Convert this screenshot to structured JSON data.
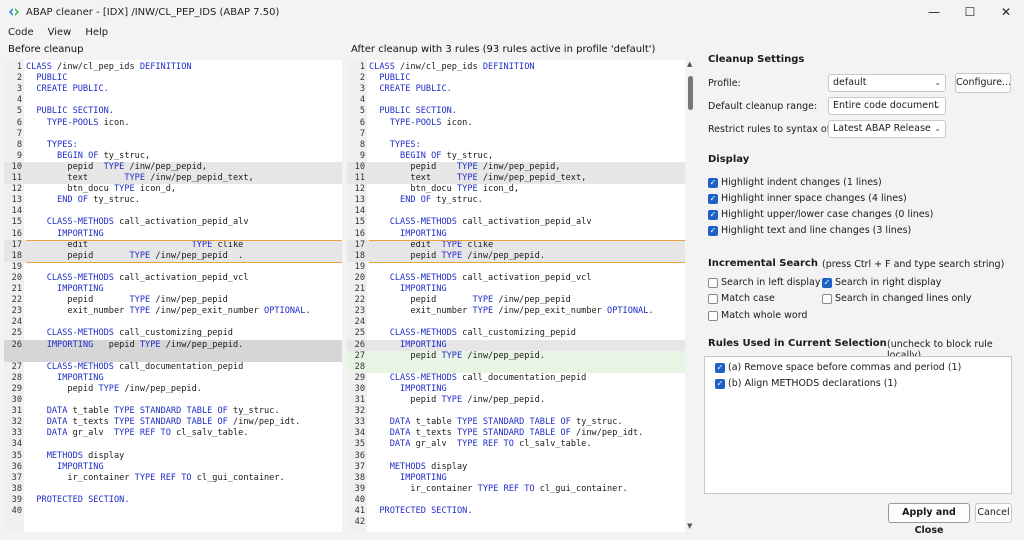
{
  "window": {
    "title": "ABAP cleaner - [IDX] /INW/CL_PEP_IDS (ABAP 7.50)",
    "minimize": "—",
    "maximize": "☐",
    "close": "✕"
  },
  "menu": [
    "Code",
    "View",
    "Help"
  ],
  "left_label": "Before cleanup",
  "right_label": "After cleanup with 3 rules (93 rules active in profile 'default')",
  "settings": {
    "title": "Cleanup Settings",
    "profile_label": "Profile:",
    "profile_value": "default",
    "configure": "Configure...",
    "range_label": "Default cleanup range:",
    "range_value": "Entire code document",
    "restrict_label": "Restrict rules to syntax of:",
    "restrict_value": "Latest ABAP Release",
    "display_title": "Display",
    "display_options": [
      "Highlight indent changes (1 lines)",
      "Highlight inner space changes (4 lines)",
      "Highlight upper/lower case changes (0 lines)",
      "Highlight text and line changes (3 lines)"
    ],
    "search_title": "Incremental Search",
    "search_hint": "(press Ctrl + F and type search string)",
    "search_left": "Search in left display",
    "search_right": "Search in right display",
    "match_case": "Match case",
    "search_changed": "Search in changed lines only",
    "match_whole": "Match whole word",
    "rules_title": "Rules Used in Current Selection",
    "rules_hint": "(uncheck to block rule locally)",
    "rules": [
      "(a) Remove space before commas and period (1)",
      "(b) Align METHODS declarations (1)"
    ],
    "apply": "Apply and Close",
    "cancel": "Cancel"
  },
  "left_lines": [
    {
      "n": "1",
      "t": "CLASS /inw/cl_pep_ids DEFINITION"
    },
    {
      "n": "2",
      "t": "  PUBLIC"
    },
    {
      "n": "3",
      "t": "  CREATE PUBLIC."
    },
    {
      "n": "4",
      "t": ""
    },
    {
      "n": "5",
      "t": "  PUBLIC SECTION."
    },
    {
      "n": "6",
      "t": "    TYPE-POOLS icon."
    },
    {
      "n": "7",
      "t": ""
    },
    {
      "n": "8",
      "t": "    TYPES:"
    },
    {
      "n": "9",
      "t": "      BEGIN OF ty_struc,"
    },
    {
      "n": "10",
      "t": "        pepid  TYPE /inw/pep_pepid,"
    },
    {
      "n": "11",
      "t": "        text       TYPE /inw/pep_pepid_text,"
    },
    {
      "n": "12",
      "t": "        btn_docu TYPE icon_d,"
    },
    {
      "n": "13",
      "t": "      END OF ty_struc."
    },
    {
      "n": "14",
      "t": ""
    },
    {
      "n": "15",
      "t": "    CLASS-METHODS call_activation_pepid_alv"
    },
    {
      "n": "16",
      "t": "      IMPORTING"
    },
    {
      "n": "17",
      "t": "        edit                    TYPE clike"
    },
    {
      "n": "18",
      "t": "        pepid       TYPE /inw/pep_pepid  ."
    },
    {
      "n": "19",
      "t": ""
    },
    {
      "n": "20",
      "t": "    CLASS-METHODS call_activation_pepid_vcl"
    },
    {
      "n": "21",
      "t": "      IMPORTING"
    },
    {
      "n": "22",
      "t": "        pepid       TYPE /inw/pep_pepid"
    },
    {
      "n": "23",
      "t": "        exit_number TYPE /inw/pep_exit_number OPTIONAL."
    },
    {
      "n": "24",
      "t": ""
    },
    {
      "n": "25",
      "t": "    CLASS-METHODS call_customizing_pepid"
    },
    {
      "n": "26",
      "t": "    IMPORTING   pepid TYPE /inw/pep_pepid."
    },
    {
      "n": "",
      "t": ""
    },
    {
      "n": "27",
      "t": "    CLASS-METHODS call_documentation_pepid"
    },
    {
      "n": "28",
      "t": "      IMPORTING"
    },
    {
      "n": "29",
      "t": "        pepid TYPE /inw/pep_pepid."
    },
    {
      "n": "30",
      "t": ""
    },
    {
      "n": "31",
      "t": "    DATA t_table TYPE STANDARD TABLE OF ty_struc."
    },
    {
      "n": "32",
      "t": "    DATA t_texts TYPE STANDARD TABLE OF /inw/pep_idt."
    },
    {
      "n": "33",
      "t": "    DATA gr_alv  TYPE REF TO cl_salv_table."
    },
    {
      "n": "34",
      "t": ""
    },
    {
      "n": "35",
      "t": "    METHODS display"
    },
    {
      "n": "36",
      "t": "      IMPORTING"
    },
    {
      "n": "37",
      "t": "        ir_container TYPE REF TO cl_gui_container."
    },
    {
      "n": "38",
      "t": ""
    },
    {
      "n": "39",
      "t": "  PROTECTED SECTION."
    },
    {
      "n": "40",
      "t": ""
    }
  ],
  "right_lines": [
    {
      "n": "1",
      "t": "CLASS /inw/cl_pep_ids DEFINITION"
    },
    {
      "n": "2",
      "t": "  PUBLIC"
    },
    {
      "n": "3",
      "t": "  CREATE PUBLIC."
    },
    {
      "n": "4",
      "t": ""
    },
    {
      "n": "5",
      "t": "  PUBLIC SECTION."
    },
    {
      "n": "6",
      "t": "    TYPE-POOLS icon."
    },
    {
      "n": "7",
      "t": ""
    },
    {
      "n": "8",
      "t": "    TYPES:"
    },
    {
      "n": "9",
      "t": "      BEGIN OF ty_struc,"
    },
    {
      "n": "10",
      "t": "        pepid    TYPE /inw/pep_pepid,"
    },
    {
      "n": "11",
      "t": "        text     TYPE /inw/pep_pepid_text,"
    },
    {
      "n": "12",
      "t": "        btn_docu TYPE icon_d,"
    },
    {
      "n": "13",
      "t": "      END OF ty_struc."
    },
    {
      "n": "14",
      "t": ""
    },
    {
      "n": "15",
      "t": "    CLASS-METHODS call_activation_pepid_alv"
    },
    {
      "n": "16",
      "t": "      IMPORTING"
    },
    {
      "n": "17",
      "t": "        edit  TYPE clike"
    },
    {
      "n": "18",
      "t": "        pepid TYPE /inw/pep_pepid."
    },
    {
      "n": "19",
      "t": ""
    },
    {
      "n": "20",
      "t": "    CLASS-METHODS call_activation_pepid_vcl"
    },
    {
      "n": "21",
      "t": "      IMPORTING"
    },
    {
      "n": "22",
      "t": "        pepid       TYPE /inw/pep_pepid"
    },
    {
      "n": "23",
      "t": "        exit_number TYPE /inw/pep_exit_number OPTIONAL."
    },
    {
      "n": "24",
      "t": ""
    },
    {
      "n": "25",
      "t": "    CLASS-METHODS call_customizing_pepid"
    },
    {
      "n": "26",
      "t": "      IMPORTING"
    },
    {
      "n": "27",
      "t": "        pepid TYPE /inw/pep_pepid."
    },
    {
      "n": "28",
      "t": ""
    },
    {
      "n": "29",
      "t": "    CLASS-METHODS call_documentation_pepid"
    },
    {
      "n": "30",
      "t": "      IMPORTING"
    },
    {
      "n": "31",
      "t": "        pepid TYPE /inw/pep_pepid."
    },
    {
      "n": "32",
      "t": ""
    },
    {
      "n": "33",
      "t": "    DATA t_table TYPE STANDARD TABLE OF ty_struc."
    },
    {
      "n": "34",
      "t": "    DATA t_texts TYPE STANDARD TABLE OF /inw/pep_idt."
    },
    {
      "n": "35",
      "t": "    DATA gr_alv  TYPE REF TO cl_salv_table."
    },
    {
      "n": "36",
      "t": ""
    },
    {
      "n": "37",
      "t": "    METHODS display"
    },
    {
      "n": "38",
      "t": "      IMPORTING"
    },
    {
      "n": "39",
      "t": "        ir_container TYPE REF TO cl_gui_container."
    },
    {
      "n": "40",
      "t": ""
    },
    {
      "n": "41",
      "t": "  PROTECTED SECTION."
    },
    {
      "n": "42",
      "t": ""
    }
  ]
}
